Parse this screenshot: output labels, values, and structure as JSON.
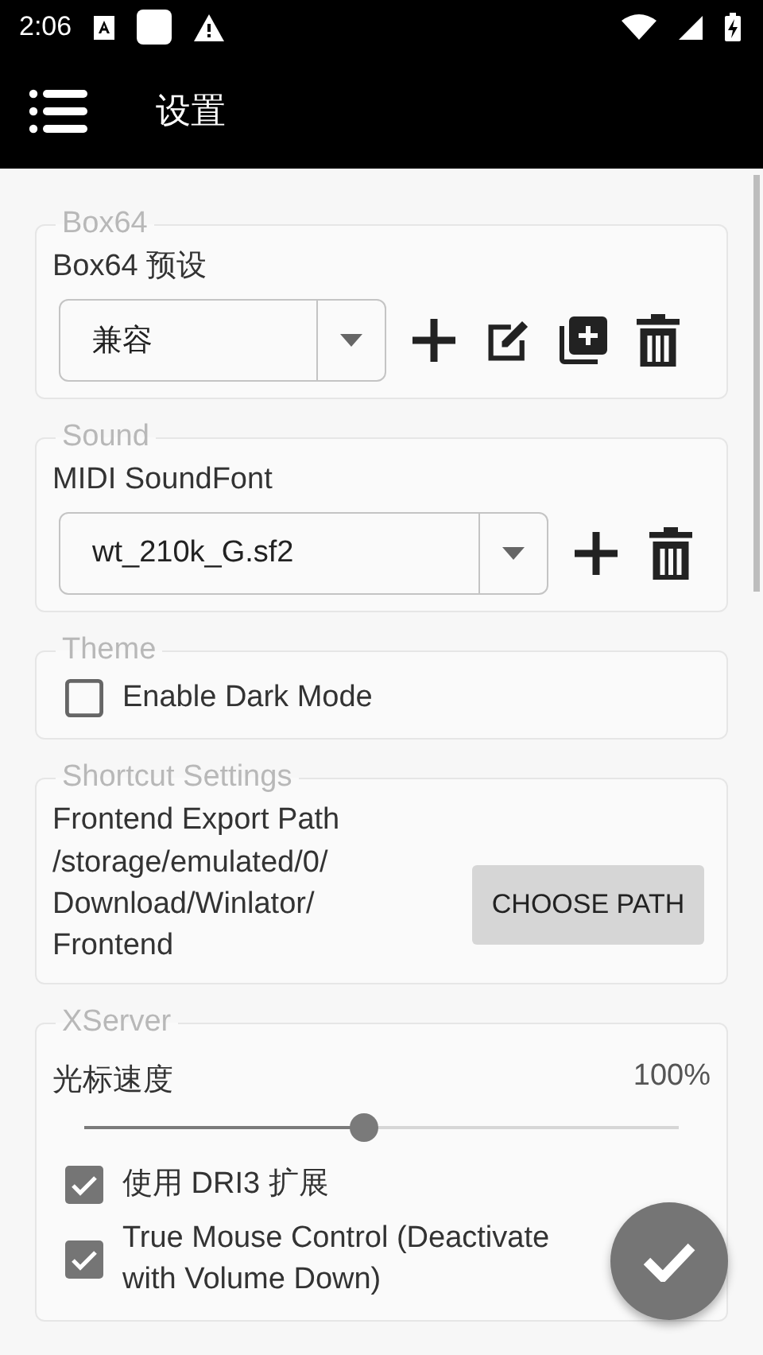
{
  "status_bar": {
    "time": "2:06"
  },
  "app_bar": {
    "title": "设置"
  },
  "sections": [
    {
      "title": "Box64",
      "rows": [
        {
          "kind": "spinner",
          "label": "Box64 预设",
          "value": "兼容",
          "actions": [
            {
              "kind": "add"
            },
            {
              "kind": "edit"
            },
            {
              "kind": "duplicate"
            },
            {
              "kind": "delete"
            }
          ]
        }
      ]
    },
    {
      "title": "Sound",
      "rows": [
        {
          "kind": "spinner",
          "label": "MIDI SoundFont",
          "value": "wt_210k_G.sf2",
          "actions": [
            {
              "kind": "add"
            },
            {
              "kind": "delete"
            }
          ]
        }
      ]
    },
    {
      "title": "Theme",
      "rows": [
        {
          "kind": "checkbox",
          "label": "Enable Dark Mode",
          "checked": false
        }
      ]
    },
    {
      "title": "Shortcut Settings",
      "rows": [
        {
          "kind": "path",
          "label": "Frontend Export Path",
          "value": "/storage/emulated/0/Download/Winlator/Frontend",
          "button": "CHOOSE PATH"
        }
      ]
    },
    {
      "title": "XServer",
      "rows": [
        {
          "kind": "slider",
          "label": "光标速度",
          "reading": "100%",
          "level": 0.47
        },
        {
          "kind": "checkbox",
          "label": "使用 DRI3 扩展",
          "checked": true
        },
        {
          "kind": "checkbox",
          "label": "True Mouse Control (Deactivate with Volume Down)",
          "checked": true
        }
      ]
    }
  ]
}
